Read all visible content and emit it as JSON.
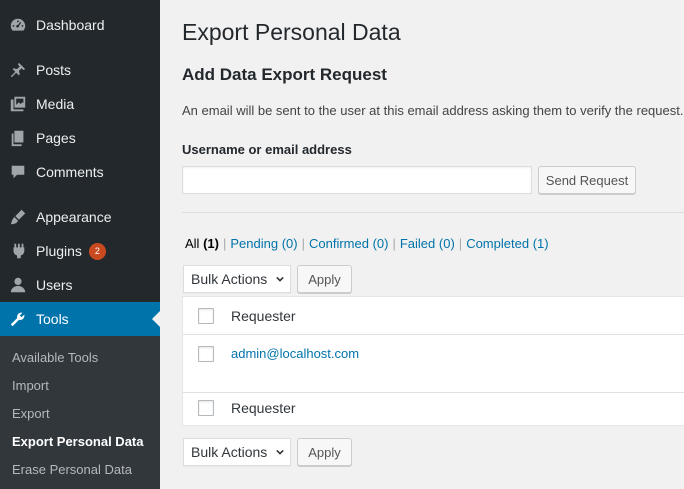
{
  "sidebar": {
    "items": [
      {
        "label": "Dashboard",
        "icon": "dashboard-icon"
      },
      {
        "label": "Posts",
        "icon": "pin-icon"
      },
      {
        "label": "Media",
        "icon": "media-icon"
      },
      {
        "label": "Pages",
        "icon": "pages-icon"
      },
      {
        "label": "Comments",
        "icon": "comment-icon"
      },
      {
        "label": "Appearance",
        "icon": "brush-icon"
      },
      {
        "label": "Plugins",
        "icon": "plugin-icon",
        "badge": "2"
      },
      {
        "label": "Users",
        "icon": "user-icon"
      },
      {
        "label": "Tools",
        "icon": "wrench-icon",
        "active": true
      }
    ],
    "submenu": [
      {
        "label": "Available Tools"
      },
      {
        "label": "Import"
      },
      {
        "label": "Export"
      },
      {
        "label": "Export Personal Data",
        "current": true
      },
      {
        "label": "Erase Personal Data"
      }
    ]
  },
  "main": {
    "title": "Export Personal Data",
    "section_title": "Add Data Export Request",
    "description": "An email will be sent to the user at this email address asking them to verify the request.",
    "field_label": "Username or email address",
    "field_value": "",
    "send_button": "Send Request",
    "filters": [
      {
        "label": "All",
        "count": "(1)",
        "current": true
      },
      {
        "label": "Pending",
        "count": "(0)"
      },
      {
        "label": "Confirmed",
        "count": "(0)"
      },
      {
        "label": "Failed",
        "count": "(0)"
      },
      {
        "label": "Completed",
        "count": "(1)"
      }
    ],
    "bulk_actions": "Bulk Actions",
    "apply_button": "Apply",
    "table": {
      "header": "Requester",
      "footer": "Requester",
      "rows": [
        {
          "requester": "admin@localhost.com"
        }
      ]
    }
  },
  "colors": {
    "sidebar_bg": "#23282d",
    "active_bg": "#0073aa",
    "link": "#0073aa",
    "badge": "#ca4a1f"
  }
}
